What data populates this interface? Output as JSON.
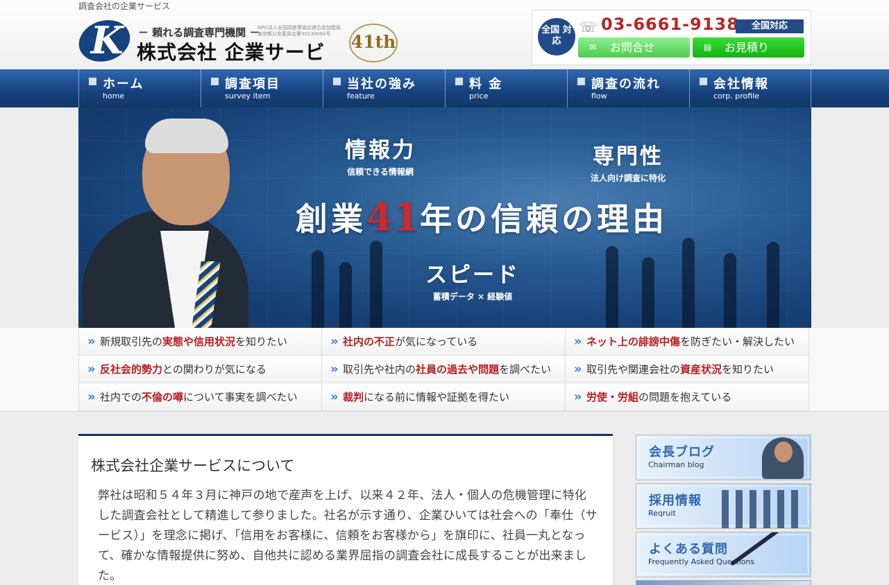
{
  "header": {
    "tagline": "調査会社の企業サービス",
    "logo_letter": "K",
    "logo_sub": "－ 頼れる調査専門機関 －",
    "logo_main": "株式会社 企業サービス",
    "npo_text": "NPO法人全国調査業協会連合会加盟員 東京都公安委員会第30130092号",
    "badge_text": "41th",
    "nationwide": "全国 対応",
    "phone": "03-6661-9138",
    "phone_tag": "全国対応",
    "inquiry": "お問合せ",
    "estimate": "お見積り"
  },
  "nav": [
    {
      "ja": "ホーム",
      "en": "home"
    },
    {
      "ja": "調査項目",
      "en": "survey item"
    },
    {
      "ja": "当社の強み",
      "en": "feature"
    },
    {
      "ja": "料 金",
      "en": "price"
    },
    {
      "ja": "調査の流れ",
      "en": "flow"
    },
    {
      "ja": "会社情報",
      "en": "corp. profile"
    }
  ],
  "hero": {
    "feature_info_title": "情報力",
    "feature_info_sub": "信頼できる情報網",
    "feature_expert_title": "専門性",
    "feature_expert_sub": "法人向け調査に特化",
    "heading_prefix": "創業",
    "heading_number": "41",
    "heading_suffix": "年の信頼の理由",
    "feature_speed_title": "スピード",
    "feature_speed_sub": "蓄積データ × 経験値"
  },
  "concerns": [
    {
      "pre": "新規取引先の",
      "strong": "実態や信用状況",
      "post": "を知りたい"
    },
    {
      "pre": "",
      "strong": "社内の不正",
      "post": "が気になっている"
    },
    {
      "pre": "",
      "strong": "ネット上の誹謗中傷",
      "post": "を防ぎたい・解決したい"
    },
    {
      "pre": "",
      "strong": "反社会的勢力",
      "post": "との関わりが気になる"
    },
    {
      "pre": "取引先や社内の",
      "strong": "社員の過去や問題",
      "post": "を調べたい"
    },
    {
      "pre": "取引先や関連会社の",
      "strong": "資産状況",
      "post": "を知りたい"
    },
    {
      "pre": "社内での",
      "strong": "不倫の噂",
      "post": "について事実を調べたい"
    },
    {
      "pre": "",
      "strong": "裁判",
      "post": "になる前に情報や証拠を得たい"
    },
    {
      "pre": "",
      "strong": "労使・労組",
      "post": "の問題を抱えている"
    }
  ],
  "about": {
    "title": "株式会社企業サービスについて",
    "text": "弊社は昭和５４年３月に神戸の地で産声を上げ、以来４２年、法人・個人の危機管理に特化した調査会社として精進して参りました。社名が示す通り、企業ひいては社会への「奉仕（サービス）」を理念に掲げ、「信用をお客様に、信頼をお客様から」を旗印に、社員一丸となって、確かな情報提供に努め、自他共に認める業界屈指の調査会社に成長することが出来ました。"
  },
  "sidebar": [
    {
      "ja": "会長ブログ",
      "en": "Chairman blog"
    },
    {
      "ja": "採用情報",
      "en": "Reqruit"
    },
    {
      "ja": "よくある質問",
      "en": "Frequently Asked Questions"
    }
  ],
  "colors": {
    "navy": "#17427f",
    "accent_red": "#b6272a",
    "cta_green": "#13b113"
  }
}
